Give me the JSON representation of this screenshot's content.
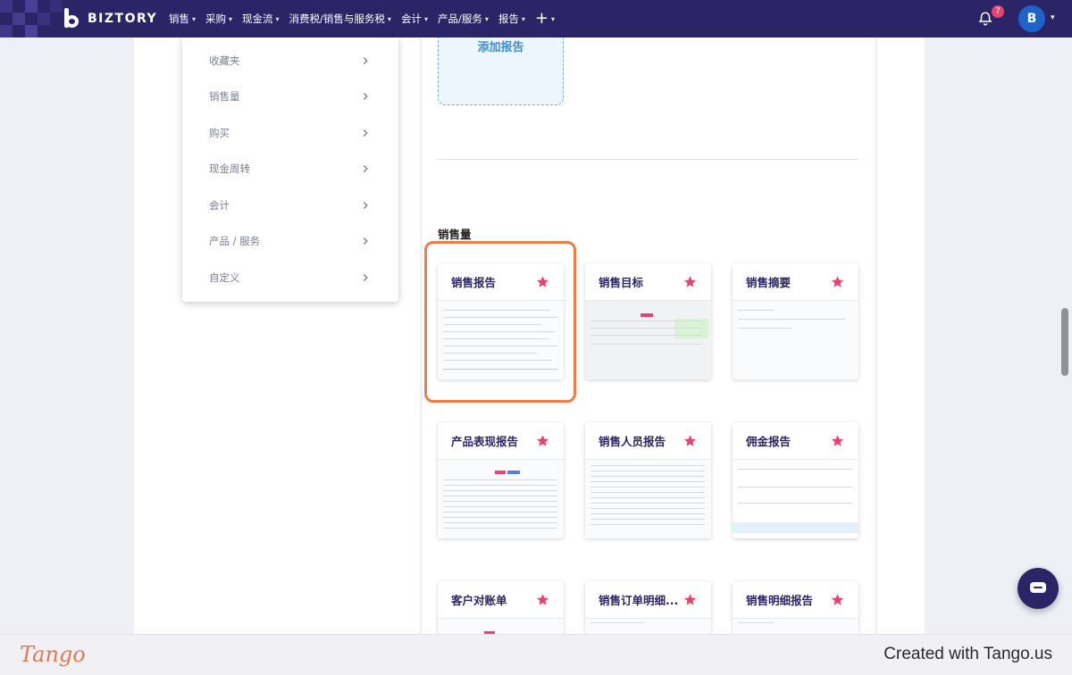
{
  "brand": {
    "name": "BIZTORY"
  },
  "nav": {
    "items": [
      "销售",
      "采购",
      "现金流",
      "消费税/销售与服务税",
      "会计",
      "产品/服务",
      "报告"
    ],
    "plus": "+"
  },
  "header": {
    "notification_count": "7",
    "avatar_initial": "B"
  },
  "sidebar": {
    "items": [
      {
        "label": "收藏夹"
      },
      {
        "label": "销售量"
      },
      {
        "label": "购买"
      },
      {
        "label": "现金周转"
      },
      {
        "label": "会计"
      },
      {
        "label": "产品 / 服务"
      },
      {
        "label": "自定义"
      }
    ]
  },
  "main": {
    "add_report_label": "添加报告",
    "section_title": "销售量",
    "reports": [
      {
        "title": "销售报告",
        "favorite": true,
        "highlighted": true
      },
      {
        "title": "销售目标",
        "favorite": true
      },
      {
        "title": "销售摘要",
        "favorite": true
      },
      {
        "title": "产品表现报告",
        "favorite": true
      },
      {
        "title": "销售人员报告",
        "favorite": true
      },
      {
        "title": "佣金报告",
        "favorite": true
      },
      {
        "title": "客户对账单",
        "favorite": true
      },
      {
        "title": "销售订单明细...",
        "favorite": true
      },
      {
        "title": "销售明细报告",
        "favorite": true
      }
    ]
  },
  "footer": {
    "logo": "Tango",
    "credit": "Created with Tango.us"
  },
  "colors": {
    "nav_bg": "#2b2467",
    "accent": "#e8436e",
    "highlight": "#f27a44",
    "link": "#3a8fd8"
  }
}
